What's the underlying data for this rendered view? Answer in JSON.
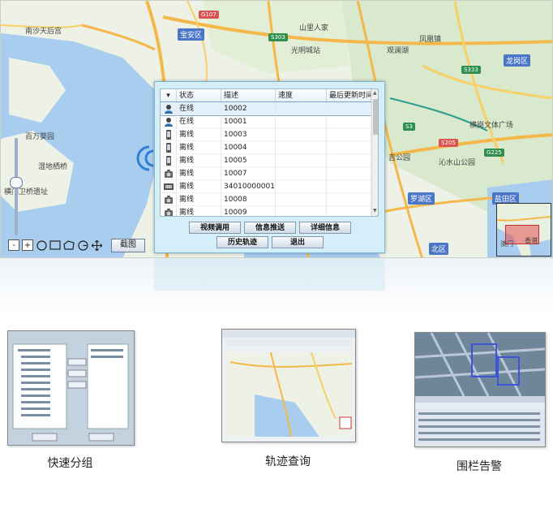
{
  "map": {
    "places": [
      "南沙天后宫",
      "宝安区",
      "山里人家",
      "光明城站",
      "凤凰镇",
      "观澜湖",
      "龙岗区",
      "百万葵园",
      "湿地栖桥",
      "横门卫桥遗址",
      "横岗文体广场",
      "吉公园",
      "沁水山公园",
      "罗湖区",
      "盐田区",
      "东莞",
      "北区",
      "澳门",
      "香港"
    ],
    "highway_badges": [
      "G107",
      "S303",
      "S333",
      "G225",
      "S205",
      "S3"
    ],
    "zoom_minus": "-",
    "zoom_plus": "+",
    "capture_label": "截图"
  },
  "dialog": {
    "columns": [
      "状态",
      "描述",
      "速度",
      "最后更新时间"
    ],
    "rows": [
      {
        "status": "在线",
        "desc": "10002",
        "icon": "person-online-icon",
        "selected": true
      },
      {
        "status": "在线",
        "desc": "10001",
        "icon": "person-online-icon",
        "selected": false
      },
      {
        "status": "离线",
        "desc": "10003",
        "icon": "phone-icon",
        "selected": false
      },
      {
        "status": "离线",
        "desc": "10004",
        "icon": "phone-icon",
        "selected": false
      },
      {
        "status": "离线",
        "desc": "10005",
        "icon": "phone-icon",
        "selected": false
      },
      {
        "status": "离线",
        "desc": "10007",
        "icon": "camera-icon",
        "selected": false
      },
      {
        "status": "离线",
        "desc": "34010000001...",
        "icon": "device-icon",
        "selected": false
      },
      {
        "status": "离线",
        "desc": "10008",
        "icon": "camera-icon",
        "selected": false
      },
      {
        "status": "离线",
        "desc": "10009",
        "icon": "camera-icon",
        "selected": false
      }
    ],
    "buttons": {
      "video": "视频调用",
      "push": "信息推送",
      "detail": "详细信息",
      "history": "历史轨迹",
      "exit": "退出"
    }
  },
  "features": [
    {
      "label": "快速分组"
    },
    {
      "label": "轨迹查询"
    },
    {
      "label": "围栏告警"
    }
  ],
  "colors": {
    "dialog_bg": "#d5effa",
    "map_bg": "#e9efe3",
    "water": "#a9cdee",
    "road": "#f4b84a"
  }
}
